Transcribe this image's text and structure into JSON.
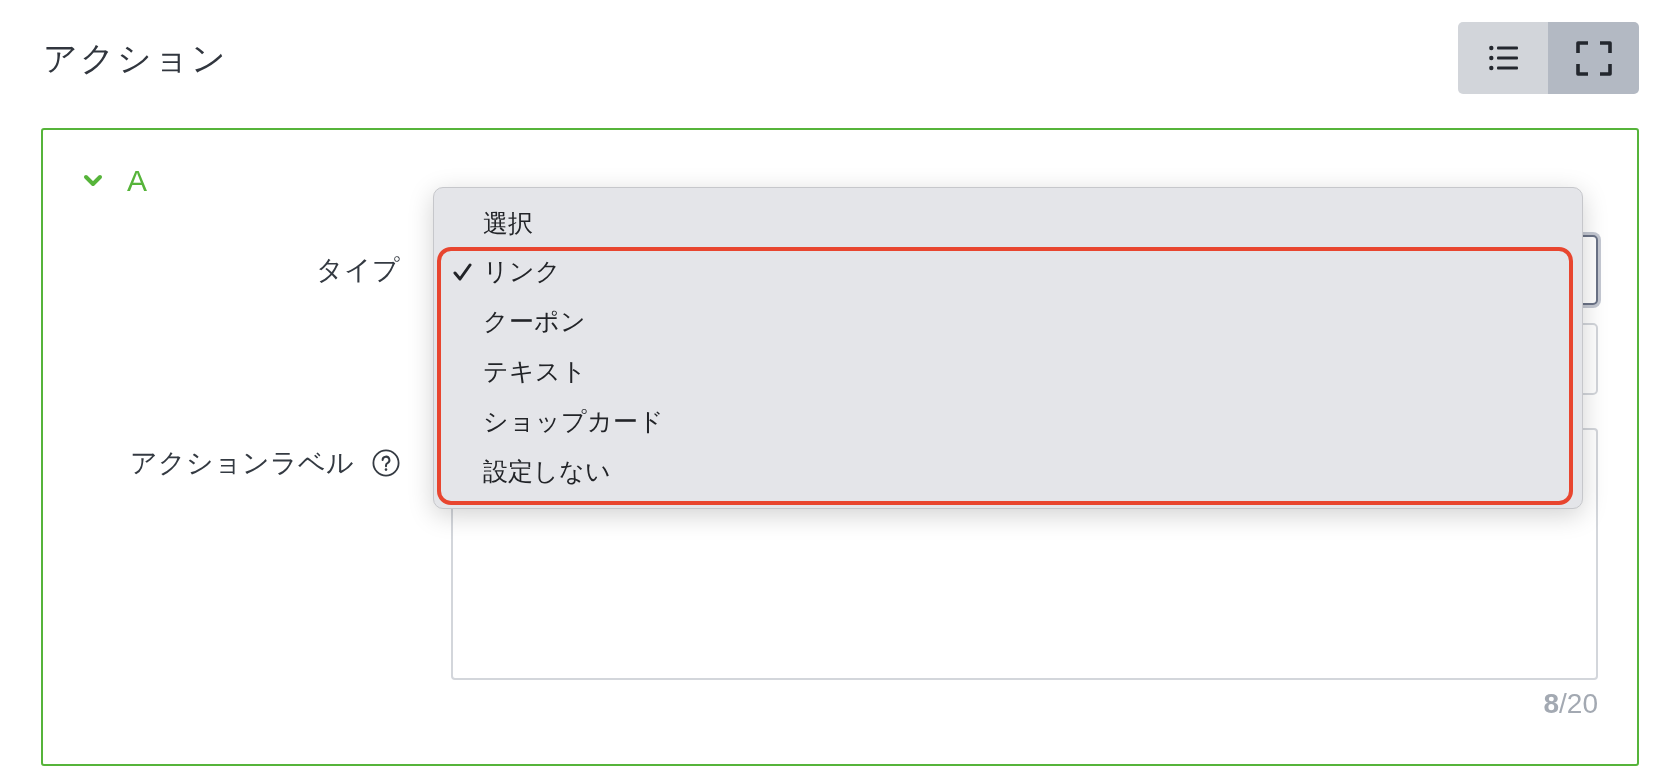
{
  "page": {
    "title": "アクション"
  },
  "view_toggle": [
    {
      "kind": "list",
      "selected": false
    },
    {
      "kind": "fullscreen",
      "selected": true
    }
  ],
  "section": {
    "title": "A",
    "expanded": true,
    "fields": [
      {
        "kind": "select",
        "label": "タイプ",
        "options": [
          {
            "label": "選択",
            "selected": false
          }
        ],
        "highlighted_options": [
          {
            "label": "リンク",
            "selected": true
          },
          {
            "label": "クーポン",
            "selected": false
          },
          {
            "label": "テキスト",
            "selected": false
          },
          {
            "label": "ショップカード",
            "selected": false
          },
          {
            "label": "設定しない",
            "selected": false
          }
        ]
      },
      {
        "kind": "input"
      },
      {
        "kind": "textarea",
        "label": "アクションラベル",
        "help_icon": true,
        "counter": "**8**/20"
      }
    ]
  }
}
